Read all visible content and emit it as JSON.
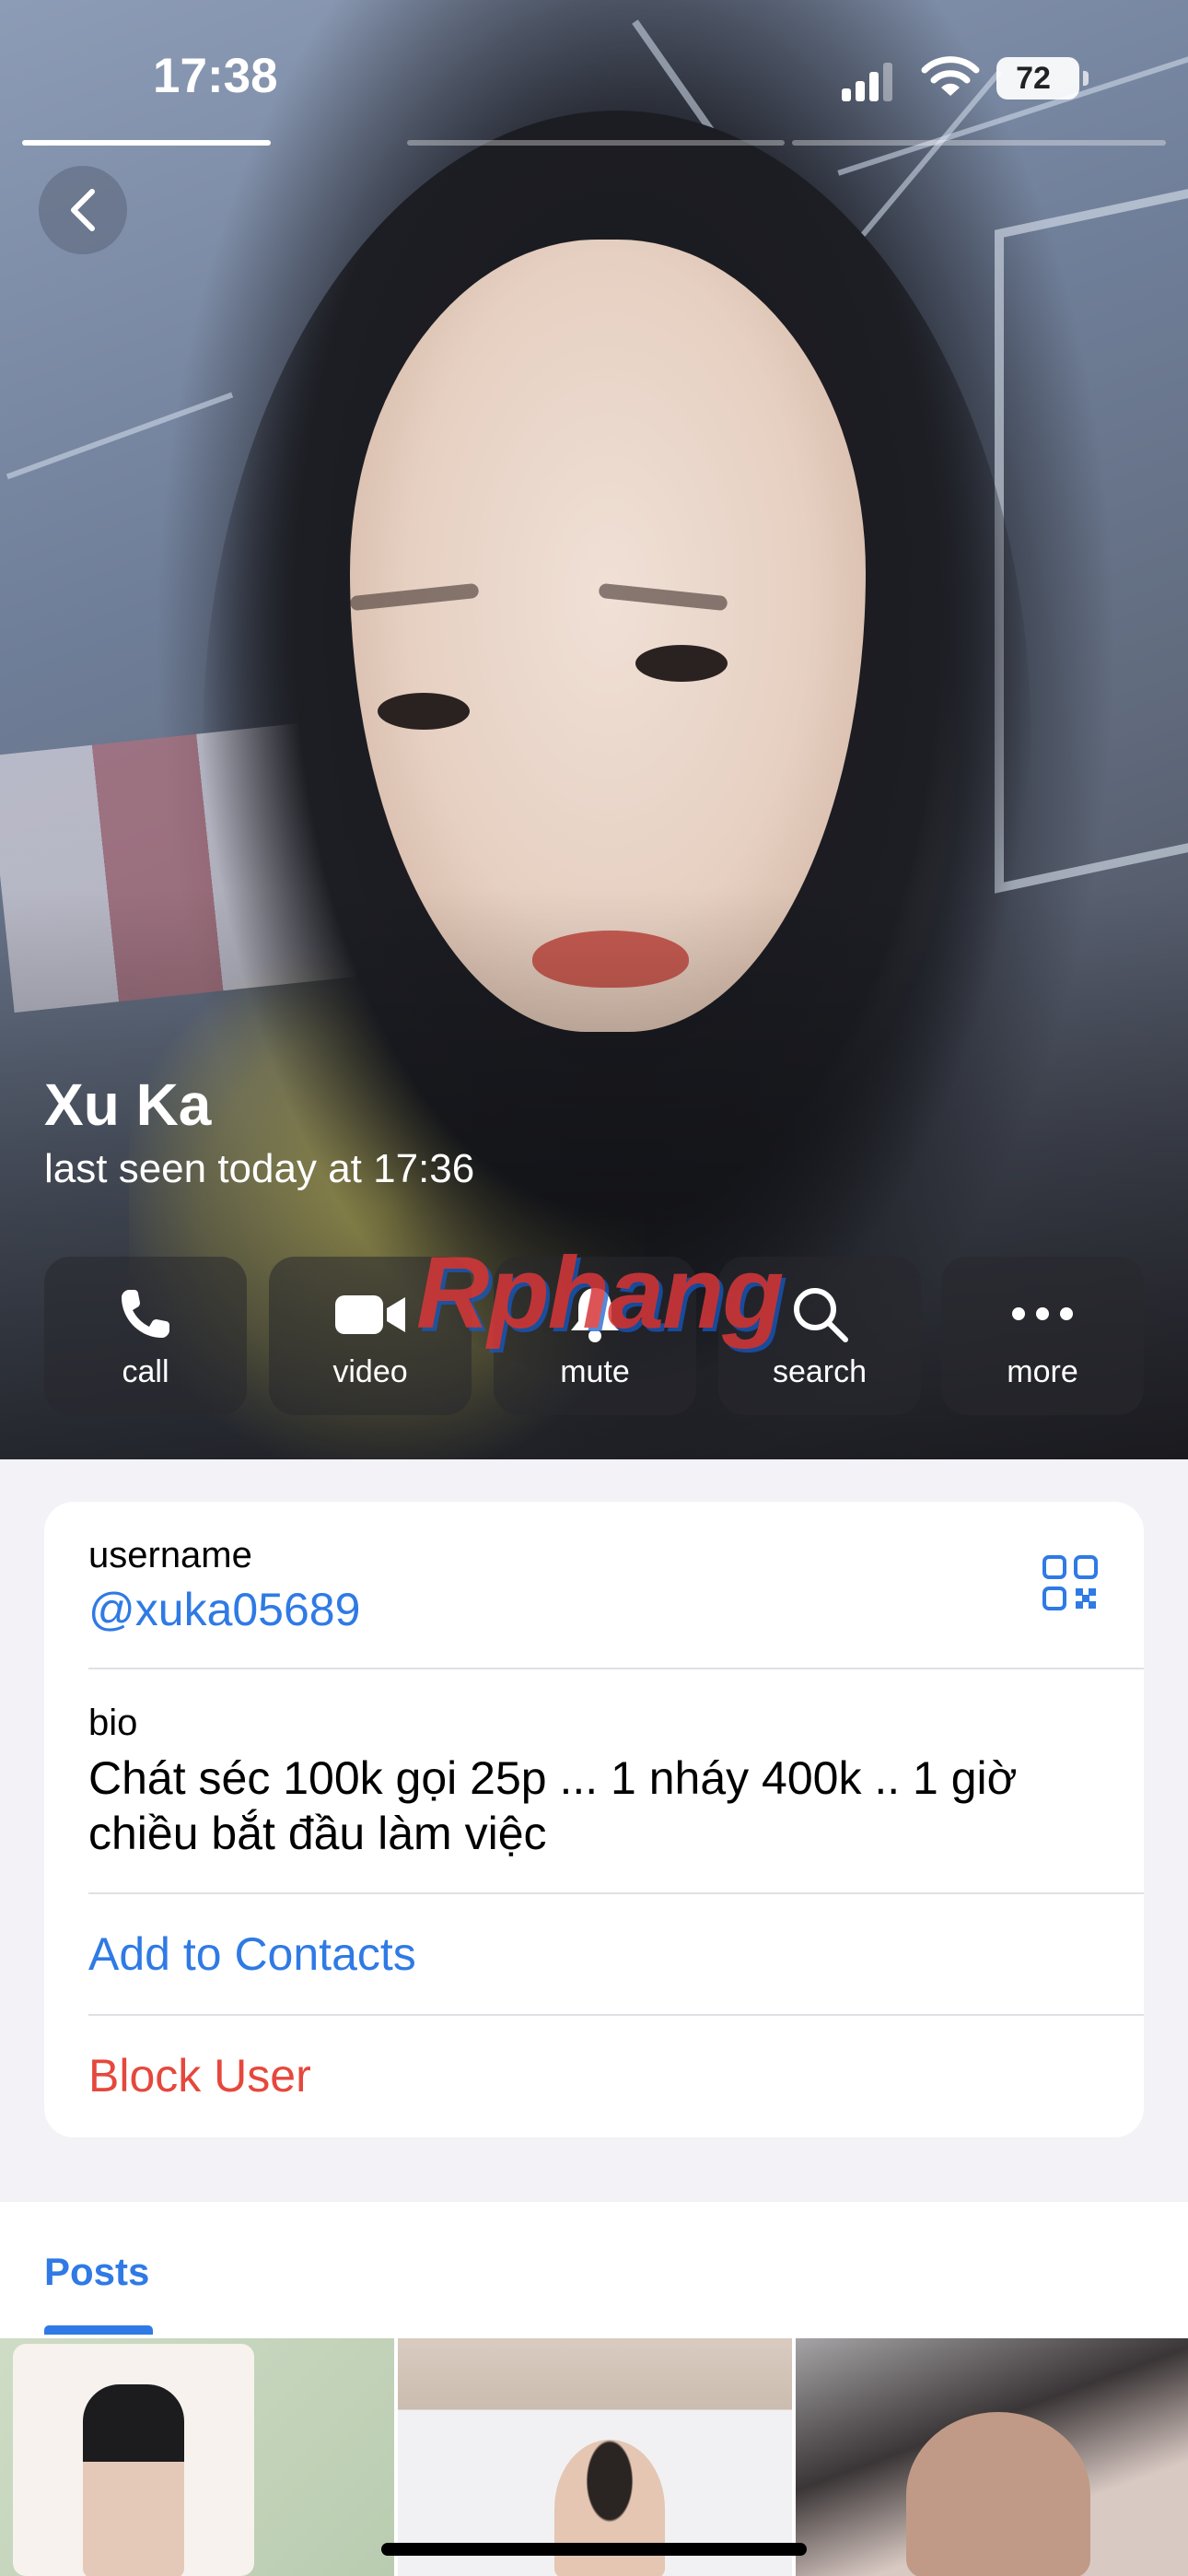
{
  "status_bar": {
    "time": "17:38",
    "battery": "72"
  },
  "profile": {
    "name": "Xu Ka",
    "status": "last seen today at 17:36"
  },
  "actions": [
    {
      "label": "call",
      "icon": "phone-icon"
    },
    {
      "label": "video",
      "icon": "video-camera-icon"
    },
    {
      "label": "mute",
      "icon": "bell-icon"
    },
    {
      "label": "search",
      "icon": "search-icon"
    },
    {
      "label": "more",
      "icon": "more-dots-icon"
    }
  ],
  "watermark": "Rphang",
  "info": {
    "username_label": "username",
    "username": "@xuka05689",
    "bio_label": "bio",
    "bio": "Chát séc 100k gọi 25p ... 1 nháy 400k .. 1 giờ chiều bắt đầu làm việc",
    "add_contact": "Add to Contacts",
    "block_user": "Block User"
  },
  "posts": {
    "tab_label": "Posts"
  },
  "colors": {
    "accent": "#2f7ae5",
    "danger": "#e5483c",
    "background": "#f2f2f7"
  }
}
